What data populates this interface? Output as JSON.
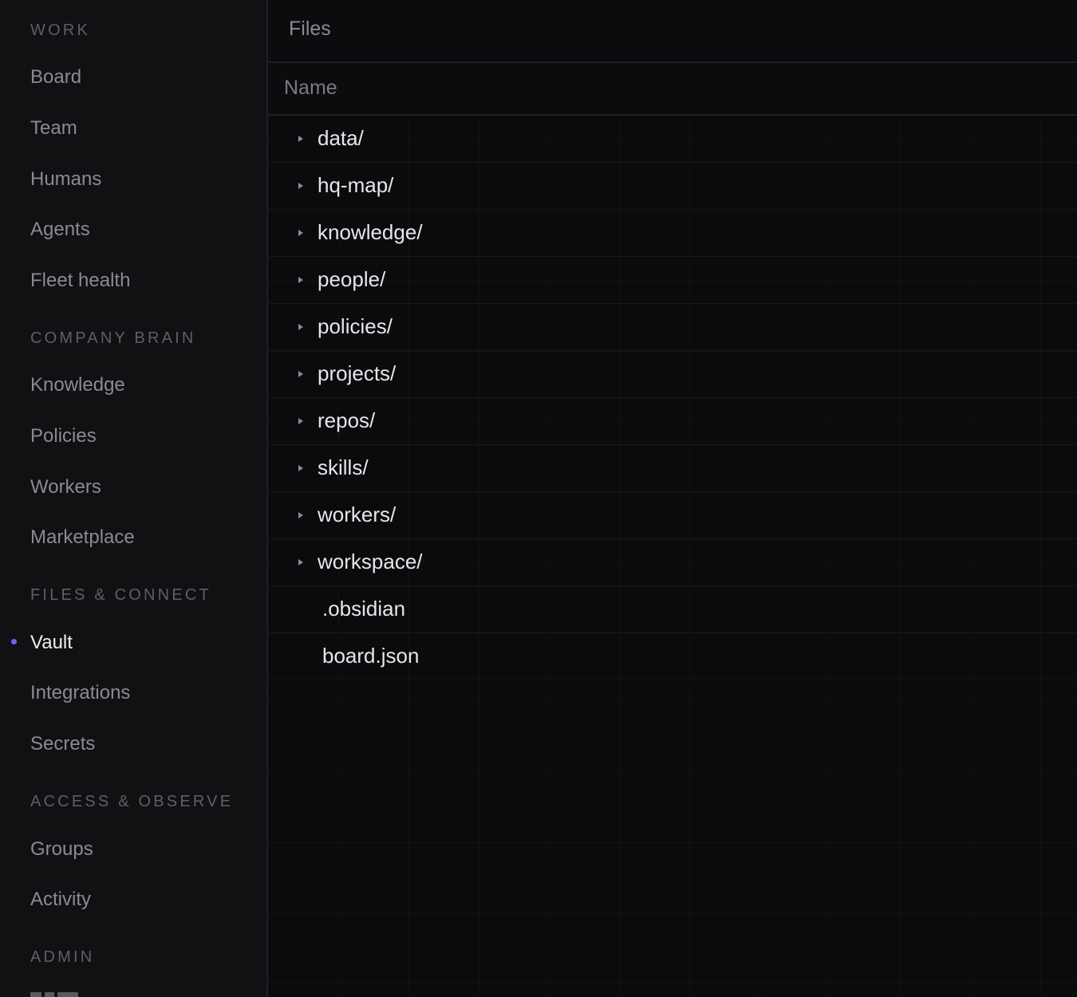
{
  "sidebar": {
    "sections": [
      {
        "label": "WORK",
        "items": [
          "Board",
          "Team",
          "Humans",
          "Agents",
          "Fleet health"
        ]
      },
      {
        "label": "COMPANY BRAIN",
        "items": [
          "Knowledge",
          "Policies",
          "Workers",
          "Marketplace"
        ]
      },
      {
        "label": "FILES & CONNECT",
        "items": [
          "Vault",
          "Integrations",
          "Secrets"
        ]
      },
      {
        "label": "ACCESS & OBSERVE",
        "items": [
          "Groups",
          "Activity"
        ]
      },
      {
        "label": "ADMIN",
        "items": []
      }
    ],
    "active_item": "Vault",
    "accent_color": "#6f64f2"
  },
  "main": {
    "title": "Files",
    "column_header": "Name",
    "rows": [
      {
        "name": "data/",
        "type": "folder"
      },
      {
        "name": "hq-map/",
        "type": "folder"
      },
      {
        "name": "knowledge/",
        "type": "folder"
      },
      {
        "name": "people/",
        "type": "folder"
      },
      {
        "name": "policies/",
        "type": "folder"
      },
      {
        "name": "projects/",
        "type": "folder"
      },
      {
        "name": "repos/",
        "type": "folder"
      },
      {
        "name": "skills/",
        "type": "folder"
      },
      {
        "name": "workers/",
        "type": "folder"
      },
      {
        "name": "workspace/",
        "type": "folder"
      },
      {
        "name": ".obsidian",
        "type": "file"
      },
      {
        "name": "board.json",
        "type": "file"
      }
    ]
  }
}
